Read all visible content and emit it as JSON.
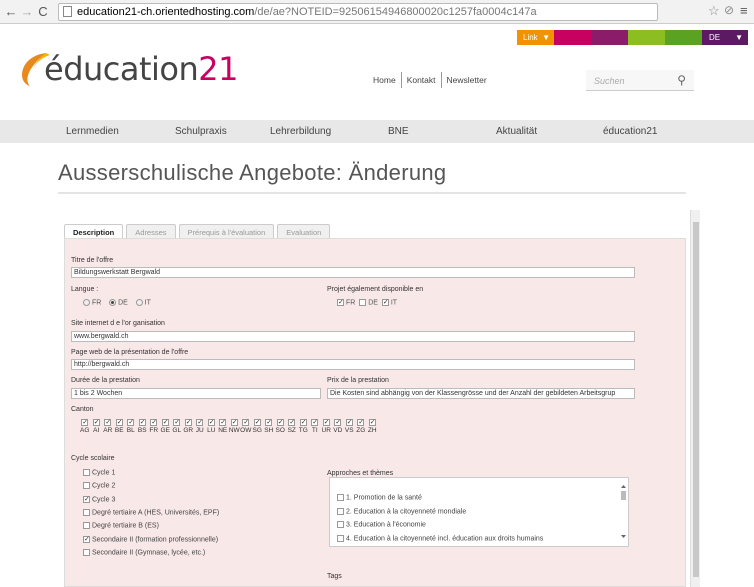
{
  "browser": {
    "url_host": "education21-ch.orientedhosting.com",
    "url_path": "/de/ae?NOTEID=92506154946800020c1257fa0004c147a"
  },
  "colorbar": {
    "link_label": "Link",
    "lang_label": "DE",
    "colors": [
      "#f39200",
      "#c8005f",
      "#8a1c6a",
      "#8cbe22",
      "#5ba222",
      "#6aa72b",
      "#5b1a62"
    ]
  },
  "logo": {
    "text_pre": "éducation",
    "text_num": "21"
  },
  "topnav": [
    "Home",
    "Kontakt",
    "Newsletter"
  ],
  "search": {
    "placeholder": "Suchen"
  },
  "mainnav": [
    "Lernmedien",
    "Schulpraxis",
    "Lehrerbildung",
    "BNE",
    "Aktualität",
    "éducation21"
  ],
  "page_title": "Ausserschulische Angebote: Änderung",
  "tabs": [
    "Description",
    "Adresses",
    "Prérequis à l'évaluation",
    "Evaluation"
  ],
  "form": {
    "titre_label": "Titre de l'offre",
    "titre_value": "Bildungswerkstatt Bergwald",
    "langue_label": "Langue :",
    "langue_options": [
      "FR",
      "DE",
      "IT"
    ],
    "langue_selected": "DE",
    "projet_label": "Projet également disponible en",
    "projet_options": [
      {
        "label": "FR",
        "checked": true
      },
      {
        "label": "DE",
        "checked": false
      },
      {
        "label": "IT",
        "checked": true
      }
    ],
    "site_label": "Site internet d e l'or ganisation",
    "site_value": "www.bergwald.ch",
    "pageweb_label": "Page web de la présentation de l'offre",
    "pageweb_value": "http://bergwald.ch",
    "duree_label": "Durée de la prestation",
    "duree_value": "1 bis 2 Wochen",
    "prix_label": "Prix de la prestation",
    "prix_value": "Die Kosten sind abhängig von der Klassengrösse und der Anzahl der gebildeten Arbeitsgrup",
    "canton_label": "Canton",
    "cantons": [
      "AG",
      "AI",
      "AR",
      "BE",
      "BL",
      "BS",
      "FR",
      "GE",
      "GL",
      "GR",
      "JU",
      "LU",
      "NE",
      "NW",
      "OW",
      "SG",
      "SH",
      "SO",
      "SZ",
      "TG",
      "TI",
      "UR",
      "VD",
      "VS",
      "ZG",
      "ZH"
    ],
    "cycle_label": "Cycle scolaire",
    "cycles": [
      {
        "label": "Cycle 1",
        "checked": false
      },
      {
        "label": "Cycle 2",
        "checked": false
      },
      {
        "label": "Cycle 3",
        "checked": true
      },
      {
        "label": "Degré tertiaire A (HES, Universités, EPF)",
        "checked": false
      },
      {
        "label": "Degré tertiaire B (ES)",
        "checked": false
      },
      {
        "label": "Secondaire II (formation professionnelle)",
        "checked": true
      },
      {
        "label": "Secondaire II (Gymnase, lycée, etc.)",
        "checked": false
      }
    ],
    "approches_label": "Approches et thèmes",
    "approches": [
      "1. Promotion de la santé",
      "2. Education à la citoyenneté mondiale",
      "3. Education à l'économie",
      "4. Education à la citoyenneté incl. éducation aux droits humains"
    ],
    "tags_label": "Tags"
  }
}
